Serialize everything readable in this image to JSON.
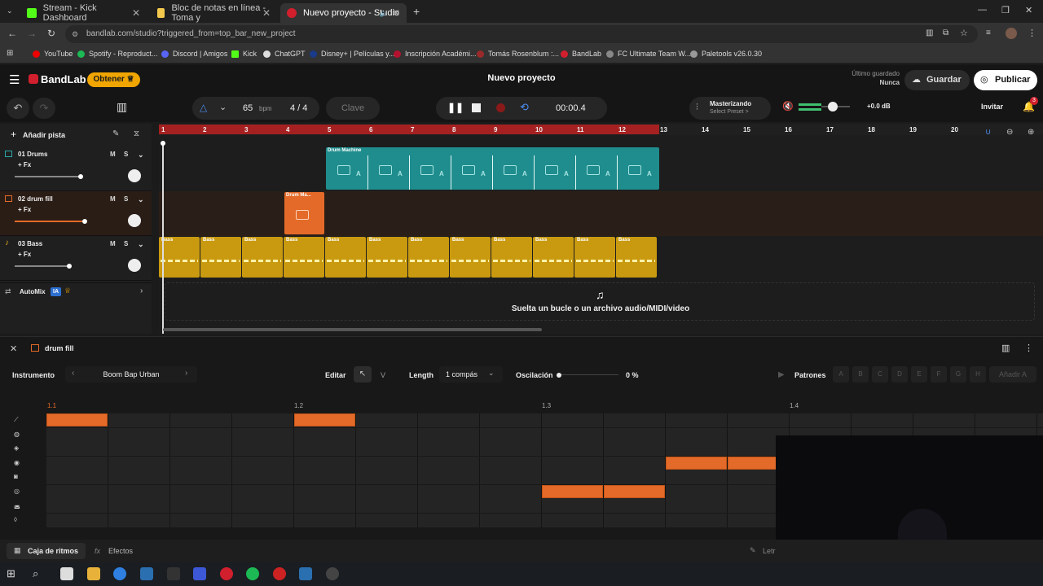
{
  "browser": {
    "tabs": [
      {
        "label": "Stream - Kick Dashboard",
        "color": "#53fc18"
      },
      {
        "label": "Bloc de notas en línea - Toma y",
        "color": "#f2c94c"
      },
      {
        "label": "Nuevo proyecto - Studio",
        "color": "#d11f2d"
      }
    ],
    "url": "bandlab.com/studio?triggered_from=top_bar_new_project",
    "bookmarks": [
      "YouTube",
      "Spotify - Reproduct...",
      "Discord | Amigos",
      "Kick",
      "ChatGPT",
      "Disney+ | Películas y...",
      "Inscripción Académi...",
      "Tomás Rosenblum :...",
      "BandLab",
      "FC Ultimate Team W...",
      "Paletools v26.0.30"
    ]
  },
  "header": {
    "brand": "BandLab",
    "upgrade": "Obtener ♕",
    "title": "Nuevo proyecto",
    "saved_label": "Último guardado",
    "saved_value": "Nunca",
    "save": "Guardar",
    "publish": "Publicar"
  },
  "toolbar": {
    "bpm": "65",
    "bpm_unit": "bpm",
    "time_sig": "4 / 4",
    "key": "Clave",
    "time": "00:00.4",
    "mastering": "Masterizando",
    "preset": "Select Preset >",
    "gain": "+0.0 dB",
    "invite": "Invitar",
    "notif": "3"
  },
  "tracks_panel": {
    "add_track": "Añadir pista",
    "tracks": [
      {
        "name": "01  Drums",
        "fx": "+ Fx",
        "vol": 0.72,
        "color": "#2aa6a6"
      },
      {
        "name": "02  drum fill",
        "fx": "+ Fx",
        "vol": 0.76,
        "color": "#e46a29"
      },
      {
        "name": "03  Bass",
        "fx": "+ Fx",
        "vol": 0.6,
        "color": "#d9a316"
      }
    ],
    "automix": "AutoMix",
    "ia": "IA"
  },
  "ruler": [
    "1",
    "2",
    "3",
    "4",
    "5",
    "6",
    "7",
    "8",
    "9",
    "10",
    "11",
    "12",
    "13",
    "14",
    "15",
    "16",
    "17",
    "18",
    "19",
    "20"
  ],
  "clips": {
    "drum_machine": "Drum Machine",
    "drum_fill": "Drum Ma...",
    "bass": "Bass"
  },
  "drop_hint": "Suelta un bucle o un archivo audio/MIDI/video",
  "editor": {
    "title": "drum fill",
    "instrument_label": "Instrumento",
    "instrument": "Boom Bap Urban",
    "edit": "Editar",
    "edit_v": "V",
    "length_label": "Length",
    "length_value": "1 compás",
    "swing_label": "Oscilación",
    "swing_value": "0 %",
    "patterns": "Patrones",
    "pattern_slots": [
      "A",
      "B",
      "C",
      "D",
      "E",
      "F",
      "G",
      "H"
    ],
    "add_pattern": "Añadir A",
    "beats": [
      "1.1",
      "1.2",
      "1.3",
      "1.4"
    ]
  },
  "footer": {
    "beats_box": "Caja de ritmos",
    "effects": "Efectos",
    "lyrics": "Letr"
  }
}
